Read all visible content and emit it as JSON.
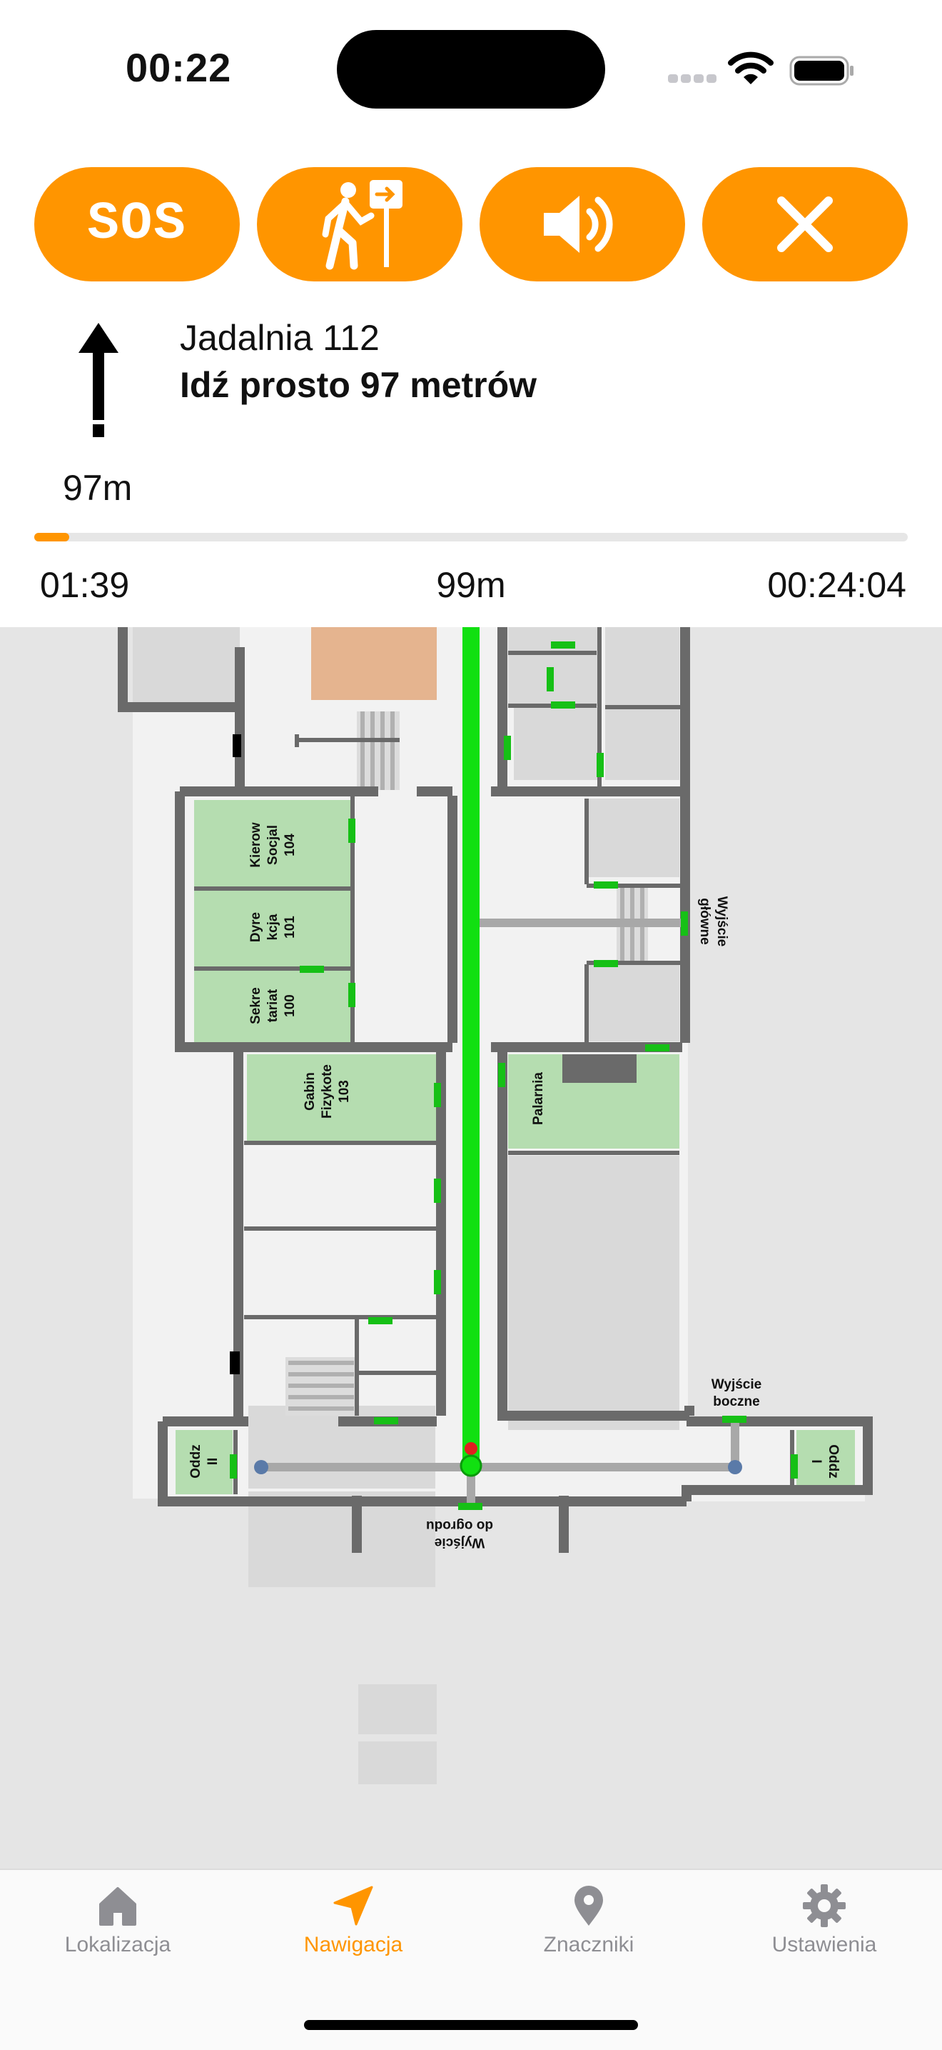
{
  "status_bar": {
    "time": "00:22"
  },
  "toolbar": {
    "buttons": [
      {
        "label": "SOS",
        "icon": "sos-icon"
      },
      {
        "icon": "walking-exit-icon"
      },
      {
        "icon": "speaker-icon"
      },
      {
        "icon": "close-icon"
      }
    ],
    "accent": "#ff9500"
  },
  "navigation": {
    "destination": "Jadalnia 112",
    "instruction": "Idź prosto 97 metrów",
    "distance_to_turn": "97m",
    "direction_icon": "arrow-up-icon",
    "progress": 0.04,
    "elapsed": "01:39",
    "remaining_distance": "99m",
    "eta": "00:24:04"
  },
  "map": {
    "route_color": "#11e011",
    "rooms": [
      {
        "name": "Kierow Socjal 104",
        "lines": [
          "Kierow",
          "Socjal",
          "104"
        ]
      },
      {
        "name": "Dyre kcja 101",
        "lines": [
          "Dyre",
          "kcja",
          "101"
        ]
      },
      {
        "name": "Sekre tariat 100",
        "lines": [
          "Sekre",
          "tariat",
          "100"
        ]
      },
      {
        "name": "Gabin Fizykote 103",
        "lines": [
          "Gabin",
          "Fizykote",
          "103"
        ]
      },
      {
        "name": "Palarnia",
        "lines": [
          "Palarnia"
        ]
      },
      {
        "name": "Oddz II",
        "lines": [
          "Oddz",
          "II"
        ]
      },
      {
        "name": "Oddz I",
        "lines": [
          "Oddz",
          "I"
        ]
      }
    ],
    "exits": {
      "main": [
        "Wyjście",
        "główne"
      ],
      "side": [
        "Wyjście",
        "boczne"
      ],
      "garden": [
        "Wyjście",
        "do ogrodu"
      ]
    }
  },
  "tabs": [
    {
      "label": "Lokalizacja",
      "icon": "house-icon",
      "active": false
    },
    {
      "label": "Nawigacja",
      "icon": "navigation-arrow-icon",
      "active": true
    },
    {
      "label": "Znaczniki",
      "icon": "map-pin-icon",
      "active": false
    },
    {
      "label": "Ustawienia",
      "icon": "gear-icon",
      "active": false
    }
  ]
}
